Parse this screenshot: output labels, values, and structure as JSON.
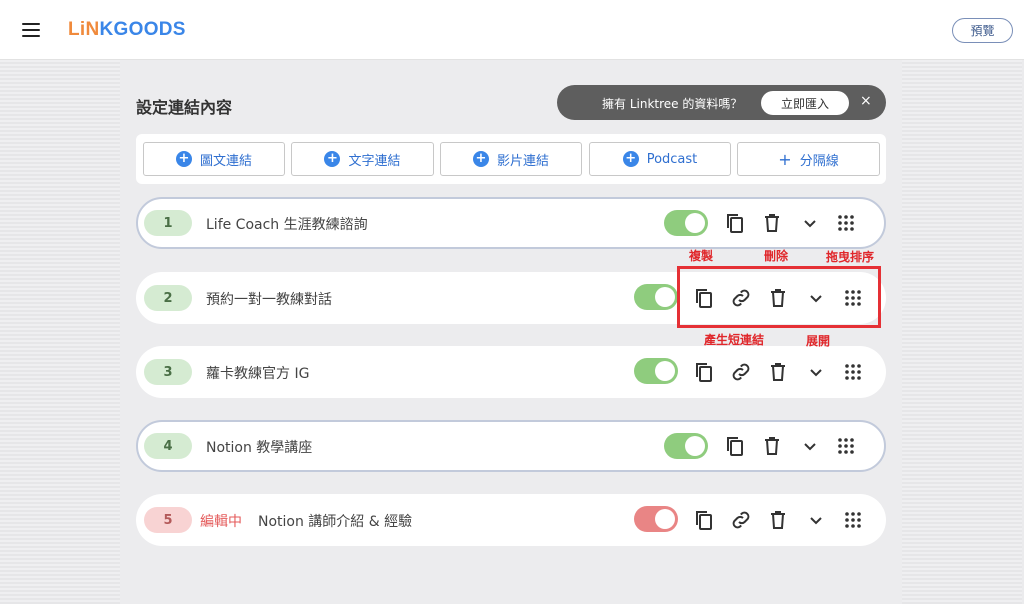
{
  "app": {
    "logo_part1": "LiN",
    "logo_part2": "KGOODS",
    "preview_label": "預覽"
  },
  "section": {
    "title": "設定連結內容"
  },
  "import_banner": {
    "text": "擁有 Linktree 的資料嗎？",
    "button_label": "立即匯入",
    "close_label": "×"
  },
  "add_buttons": [
    {
      "label": "圖文連結",
      "icon": "plus-circle-icon"
    },
    {
      "label": "文字連結",
      "icon": "plus-circle-icon"
    },
    {
      "label": "影片連結",
      "icon": "plus-circle-icon"
    },
    {
      "label": "Podcast",
      "icon": "plus-circle-icon"
    },
    {
      "label": "分隔線",
      "icon": "plus-icon"
    }
  ],
  "links": [
    {
      "number": "1",
      "title": "Life Coach 生涯教練諮詢",
      "enabled": true,
      "editing": false
    },
    {
      "number": "2",
      "title": "預約一對一教練對話",
      "enabled": true,
      "editing": false
    },
    {
      "number": "3",
      "title": "蘿卡教練官方 IG",
      "enabled": true,
      "editing": false
    },
    {
      "number": "4",
      "title": "Notion 教學講座",
      "enabled": true,
      "editing": false
    },
    {
      "number": "5",
      "title": "Notion 講師介紹 & 經驗",
      "enabled": true,
      "editing": true,
      "editing_label": "編輯中"
    }
  ],
  "annotations": {
    "copy": "複製",
    "delete": "刪除",
    "drag_sort": "拖曳排序",
    "short_link": "產生短連結",
    "expand": "展開"
  },
  "colors": {
    "toggle_on": "#8fcc7e",
    "toggle_editing": "#e98585",
    "accent_blue": "#3a86e8",
    "annotation_red": "#e53035"
  }
}
